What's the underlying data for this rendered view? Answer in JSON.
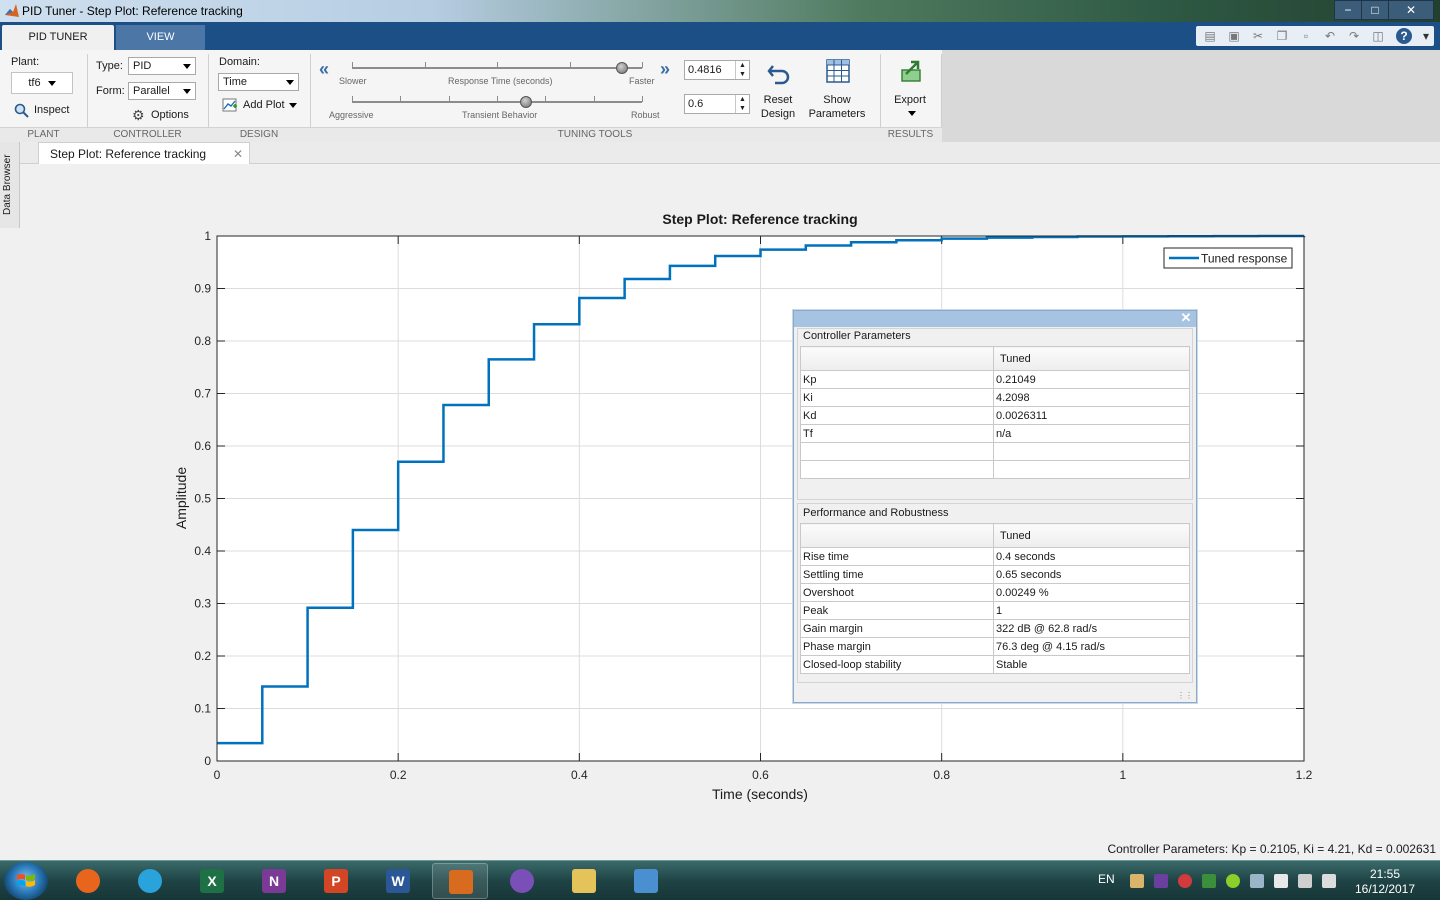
{
  "window": {
    "title": "PID Tuner - Step Plot: Reference tracking",
    "buttons": {
      "minimize": "−",
      "maximize": "□",
      "close": "✕"
    }
  },
  "tabs": {
    "active": "PID TUNER",
    "inactive": "VIEW"
  },
  "plant": {
    "label": "Plant:",
    "value": "tf6",
    "inspect": "Inspect",
    "section": "PLANT"
  },
  "controller": {
    "type_label": "Type:",
    "type_value": "PID",
    "form_label": "Form:",
    "form_value": "Parallel",
    "options": "Options",
    "section": "CONTROLLER"
  },
  "design": {
    "domain_label": "Domain:",
    "domain_value": "Time",
    "add_plot": "Add Plot",
    "section": "DESIGN"
  },
  "tuning": {
    "slower": "Slower",
    "response_time": "Response Time (seconds)",
    "faster": "Faster",
    "aggressive": "Aggressive",
    "transient": "Transient Behavior",
    "robust": "Robust",
    "response_value": "0.4816",
    "transient_value": "0.6",
    "response_slider_fraction": 0.93,
    "transient_slider_fraction": 0.6,
    "reset_line1": "Reset",
    "reset_line2": "Design",
    "show_line1": "Show",
    "show_line2": "Parameters",
    "section": "TUNING TOOLS"
  },
  "results": {
    "export": "Export",
    "section": "RESULTS"
  },
  "side_panel": {
    "label": "Data Browser"
  },
  "document_tab": {
    "label": "Step Plot: Reference tracking",
    "close": "✕"
  },
  "chart_data": {
    "type": "line",
    "title": "Step Plot: Reference tracking",
    "xlabel": "Time (seconds)",
    "ylabel": "Amplitude",
    "xlim": [
      0,
      1.2
    ],
    "ylim": [
      0,
      1
    ],
    "xticks": [
      0,
      0.2,
      0.4,
      0.6,
      0.8,
      1,
      1.2
    ],
    "xtick_labels": [
      "0",
      "0.2",
      "0.4",
      "0.6",
      "0.8",
      "1",
      "1.2"
    ],
    "yticks": [
      0,
      0.1,
      0.2,
      0.3,
      0.4,
      0.5,
      0.6,
      0.7,
      0.8,
      0.9,
      1
    ],
    "ytick_labels": [
      "0",
      "0.1",
      "0.2",
      "0.3",
      "0.4",
      "0.5",
      "0.6",
      "0.7",
      "0.8",
      "0.9",
      "1"
    ],
    "grid": true,
    "legend_position": "top-right",
    "color": "#0072bd",
    "series": [
      {
        "name": "Tuned response",
        "style": "step",
        "x": [
          0,
          0.05,
          0.1,
          0.15,
          0.2,
          0.25,
          0.3,
          0.35,
          0.4,
          0.45,
          0.5,
          0.55,
          0.6,
          0.65,
          0.7,
          0.75,
          0.8,
          0.85,
          0.9,
          0.95,
          1.0,
          1.05,
          1.1,
          1.15,
          1.2
        ],
        "y": [
          0.034,
          0.142,
          0.292,
          0.44,
          0.57,
          0.678,
          0.765,
          0.832,
          0.882,
          0.918,
          0.943,
          0.962,
          0.974,
          0.982,
          0.988,
          0.992,
          0.995,
          0.997,
          0.998,
          0.999,
          0.9993,
          0.9996,
          0.9998,
          0.9999,
          1.0
        ]
      }
    ]
  },
  "parameters_panel": {
    "close": "✕",
    "controller": {
      "title": "Controller Parameters",
      "header": "Tuned",
      "rows": [
        {
          "name": "Kp",
          "value": "0.21049"
        },
        {
          "name": "Ki",
          "value": "4.2098"
        },
        {
          "name": "Kd",
          "value": "0.0026311"
        },
        {
          "name": "Tf",
          "value": "n/a"
        }
      ]
    },
    "performance": {
      "title": "Performance and Robustness",
      "header": "Tuned",
      "rows": [
        {
          "name": "Rise time",
          "value": "0.4 seconds"
        },
        {
          "name": "Settling time",
          "value": "0.65 seconds"
        },
        {
          "name": "Overshoot",
          "value": "0.00249 %"
        },
        {
          "name": "Peak",
          "value": "1"
        },
        {
          "name": "Gain margin",
          "value": "322 dB @ 62.8 rad/s"
        },
        {
          "name": "Phase margin",
          "value": "76.3 deg @ 4.15 rad/s"
        },
        {
          "name": "Closed-loop stability",
          "value": "Stable"
        }
      ]
    }
  },
  "status": {
    "text": "Controller Parameters: Kp = 0.2105, Ki = 4.21, Kd = 0.002631"
  },
  "taskbar": {
    "apps": [
      {
        "name": "firefox",
        "letter": "",
        "color": "#e8651e"
      },
      {
        "name": "telegram",
        "letter": "",
        "color": "#2aa3dc"
      },
      {
        "name": "excel",
        "letter": "X",
        "color": "#1e7145"
      },
      {
        "name": "onenote",
        "letter": "N",
        "color": "#7b3a96"
      },
      {
        "name": "powerpoint",
        "letter": "P",
        "color": "#d24625"
      },
      {
        "name": "word",
        "letter": "W",
        "color": "#2b5797"
      },
      {
        "name": "matlab",
        "letter": "",
        "color": "#d96b1e"
      },
      {
        "name": "cat-app",
        "letter": "",
        "color": "#7a4fb8"
      },
      {
        "name": "file-explorer",
        "letter": "",
        "color": "#e3c35a"
      },
      {
        "name": "remote-desktop",
        "letter": "",
        "color": "#4a8fd0"
      }
    ],
    "language": "EN",
    "time": "21:55",
    "date": "16/12/2017"
  }
}
